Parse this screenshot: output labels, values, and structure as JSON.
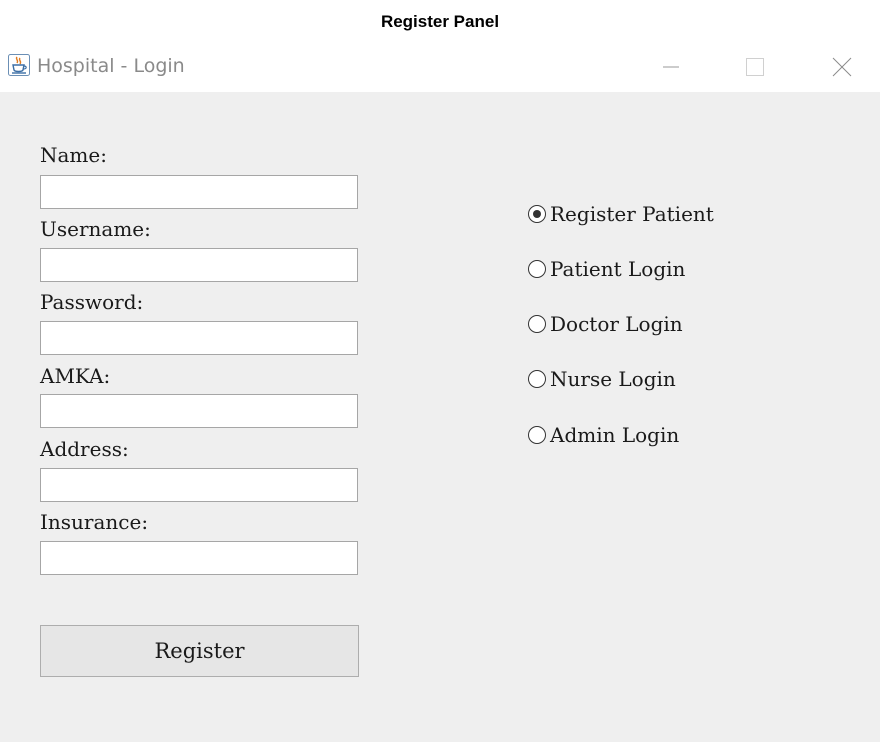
{
  "caption": "Register Panel",
  "window": {
    "title": "Hospital - Login",
    "app_icon": "java-cup-icon",
    "controls": [
      "minimize-icon",
      "maximize-icon",
      "close-icon"
    ]
  },
  "form": {
    "fields": [
      {
        "label": "Name:",
        "value": ""
      },
      {
        "label": "Username:",
        "value": ""
      },
      {
        "label": "Password:",
        "value": ""
      },
      {
        "label": "AMKA:",
        "value": ""
      },
      {
        "label": "Address:",
        "value": ""
      },
      {
        "label": "Insurance:",
        "value": ""
      }
    ],
    "register_label": "Register"
  },
  "modes": {
    "selected": "Register Patient",
    "options": [
      {
        "label": "Register Patient",
        "checked": true
      },
      {
        "label": "Patient Login",
        "checked": false
      },
      {
        "label": "Doctor Login",
        "checked": false
      },
      {
        "label": "Nurse Login",
        "checked": false
      },
      {
        "label": "Admin Login",
        "checked": false
      }
    ]
  }
}
